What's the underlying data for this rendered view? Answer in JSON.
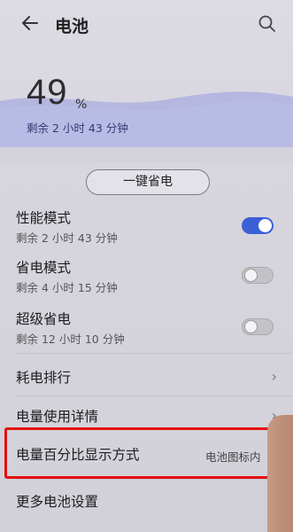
{
  "header": {
    "title": "电池"
  },
  "battery": {
    "percent": "49",
    "percent_sign": "%",
    "remaining": "剩余 2 小时 43 分钟"
  },
  "one_key_label": "一键省电",
  "modes": [
    {
      "title": "性能模式",
      "sub": "剩余 2 小时 43 分钟",
      "state": "on"
    },
    {
      "title": "省电模式",
      "sub": "剩余 4 小时 15 分钟",
      "state": "off"
    },
    {
      "title": "超级省电",
      "sub": "剩余 12 小时 10 分钟",
      "state": "off"
    }
  ],
  "menu": {
    "consumption_rank": "耗电排行",
    "usage_details": "电量使用详情",
    "percent_display": "电量百分比显示方式",
    "percent_display_value": "电池图标内",
    "more_settings": "更多电池设置"
  },
  "colors": {
    "accent": "#3b5fd6",
    "highlight": "#e60f0f",
    "wave": "#aeb1e0"
  }
}
